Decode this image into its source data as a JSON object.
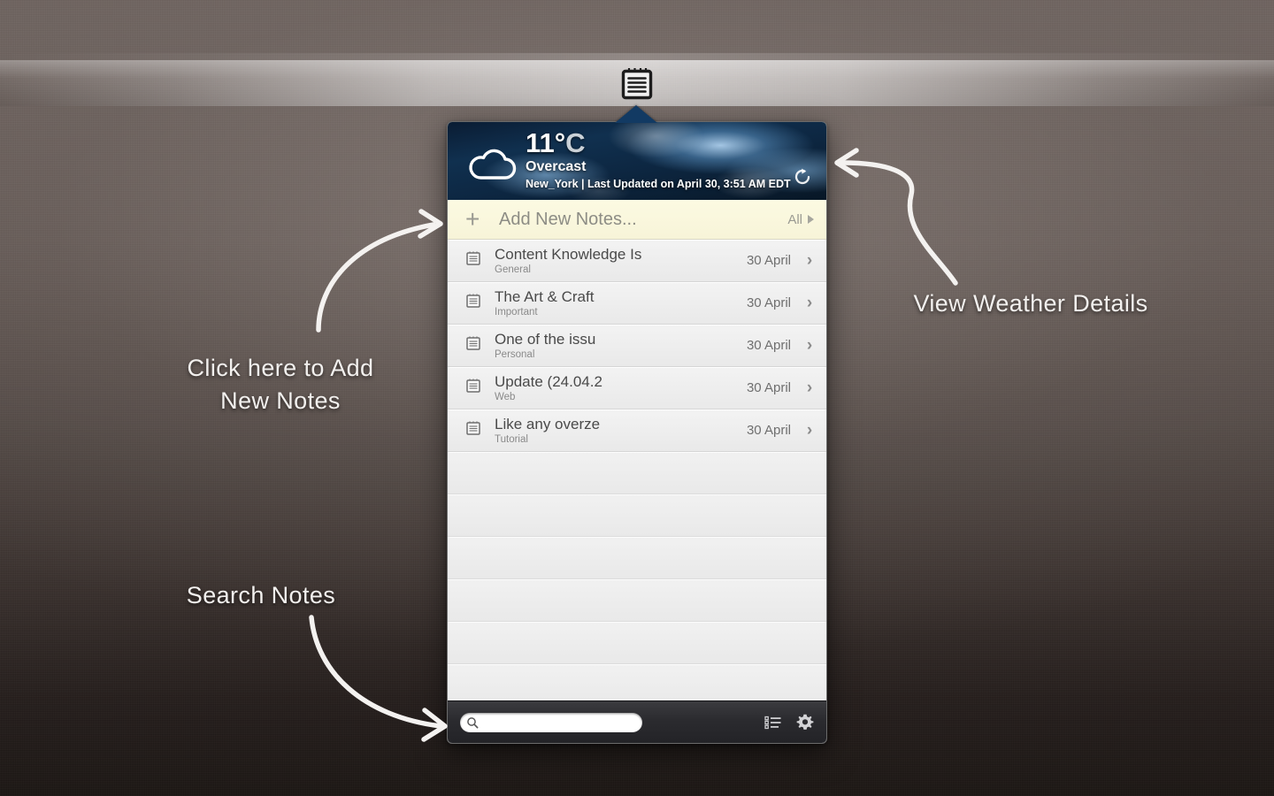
{
  "menubar": {
    "icon": "notepad-icon"
  },
  "weather": {
    "temperature": "11°",
    "unit": "C",
    "condition": "Overcast",
    "meta": "New_York | Last Updated on April 30, 3:51 AM EDT",
    "icon": "cloud-icon",
    "refresh_icon": "refresh-icon"
  },
  "add_row": {
    "plus": "+",
    "label": "Add New Notes...",
    "filter_label": "All",
    "caret_icon": "caret-right-icon"
  },
  "notes": [
    {
      "icon": "note-icon",
      "title": "Content Knowledge Is",
      "category": "General",
      "date": "30 April",
      "chevron": "›"
    },
    {
      "icon": "note-icon",
      "title": "The Art & Craft",
      "category": "Important",
      "date": "30 April",
      "chevron": "›"
    },
    {
      "icon": "note-icon",
      "title": "One of the issu",
      "category": "Personal",
      "date": "30 April",
      "chevron": "›"
    },
    {
      "icon": "note-icon",
      "title": "Update (24.04.2",
      "category": "Web",
      "date": "30 April",
      "chevron": "›"
    },
    {
      "icon": "note-icon",
      "title": "Like any overze",
      "category": "Tutorial",
      "date": "30 April",
      "chevron": "›"
    }
  ],
  "empty_rows": 6,
  "toolbar": {
    "search_placeholder": "",
    "search_value": "",
    "search_icon": "search-icon",
    "list_icon": "list-view-icon",
    "settings_icon": "gear-icon"
  },
  "annotations": {
    "add_notes_line1": "Click here to Add",
    "add_notes_line2": "New Notes",
    "weather_details": "View Weather Details",
    "search_notes": "Search Notes"
  },
  "colors": {
    "accent_cream": "#faf7dd",
    "weather_blue": "#10304f",
    "toolbar_dark": "#2b2b2f",
    "panel_gray": "#ededed"
  }
}
